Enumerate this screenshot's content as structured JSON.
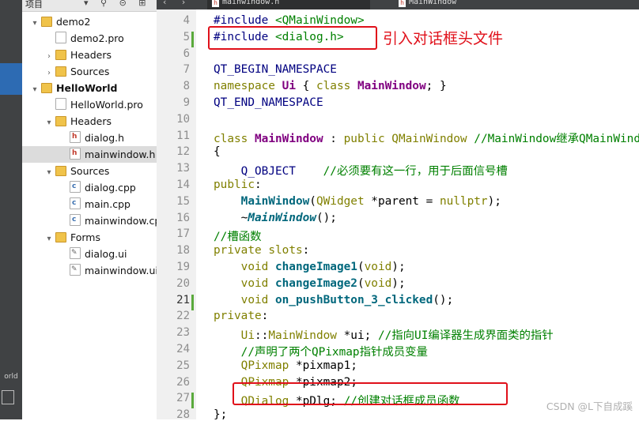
{
  "left_bar": {
    "label": "orld"
  },
  "project_tree": {
    "title": "项目",
    "toolbar_icons": [
      "filter-icon",
      "link-icon",
      "split-icon",
      "plus-icon"
    ],
    "items": [
      {
        "label": "demo2",
        "depth": 0,
        "type": "proj",
        "bold": false,
        "arrow": "▾"
      },
      {
        "label": "demo2.pro",
        "depth": 1,
        "type": "pro",
        "bold": false,
        "arrow": ""
      },
      {
        "label": "Headers",
        "depth": 1,
        "type": "folder",
        "bold": false,
        "arrow": "›"
      },
      {
        "label": "Sources",
        "depth": 1,
        "type": "folder",
        "bold": false,
        "arrow": "›"
      },
      {
        "label": "HelloWorld",
        "depth": 0,
        "type": "proj",
        "bold": true,
        "arrow": "▾"
      },
      {
        "label": "HelloWorld.pro",
        "depth": 1,
        "type": "pro",
        "bold": false,
        "arrow": ""
      },
      {
        "label": "Headers",
        "depth": 1,
        "type": "folder",
        "bold": false,
        "arrow": "▾"
      },
      {
        "label": "dialog.h",
        "depth": 2,
        "type": "hfile",
        "bold": false,
        "arrow": ""
      },
      {
        "label": "mainwindow.h",
        "depth": 2,
        "type": "hfile",
        "bold": false,
        "arrow": "",
        "selected": true
      },
      {
        "label": "Sources",
        "depth": 1,
        "type": "folder",
        "bold": false,
        "arrow": "▾"
      },
      {
        "label": "dialog.cpp",
        "depth": 2,
        "type": "cfile",
        "bold": false,
        "arrow": ""
      },
      {
        "label": "main.cpp",
        "depth": 2,
        "type": "cfile",
        "bold": false,
        "arrow": ""
      },
      {
        "label": "mainwindow.cpp",
        "depth": 2,
        "type": "cfile",
        "bold": false,
        "arrow": ""
      },
      {
        "label": "Forms",
        "depth": 1,
        "type": "forms",
        "bold": false,
        "arrow": "▾"
      },
      {
        "label": "dialog.ui",
        "depth": 2,
        "type": "ui",
        "bold": false,
        "arrow": ""
      },
      {
        "label": "mainwindow.ui",
        "depth": 2,
        "type": "ui",
        "bold": false,
        "arrow": ""
      }
    ]
  },
  "tabs": {
    "active": "mainwindow.h",
    "second": "MainWindow"
  },
  "editor": {
    "lines": [
      {
        "n": "4",
        "html": "<span class=\"mc\">#include</span> <span class=\"st\">&lt;QMainWindow&gt;</span>"
      },
      {
        "n": "5",
        "html": "<span class=\"mc\">#include</span> <span class=\"st\">&lt;dialog.h&gt;</span>"
      },
      {
        "n": "6",
        "html": ""
      },
      {
        "n": "7",
        "html": "<span class=\"ma\">QT_BEGIN_NAMESPACE</span>"
      },
      {
        "n": "8",
        "html": "<span class=\"kw\">namespace</span> <span class=\"ty\">Ui</span> { <span class=\"kw\">class</span> <span class=\"ty\">MainWindow</span>; }"
      },
      {
        "n": "9",
        "html": "<span class=\"ma\">QT_END_NAMESPACE</span>"
      },
      {
        "n": "10",
        "html": ""
      },
      {
        "n": "11",
        "html": "<span class=\"kw\">class</span> <span class=\"ty\">MainWindow</span> : <span class=\"kw\">public</span> <span class=\"kw\">QMainWindow</span> <span class=\"cm\">//MainWindow继承QMainWindow类</span>"
      },
      {
        "n": "12",
        "html": "{"
      },
      {
        "n": "13",
        "html": "    <span class=\"ma\">Q_OBJECT</span>    <span class=\"cm\">//必须要有这一行，用于后面信号槽</span>"
      },
      {
        "n": "14",
        "html": "<span class=\"kw\">public</span>:"
      },
      {
        "n": "15",
        "html": "    <span class=\"fn\">MainWindow</span>(<span class=\"kw\">QWidget</span> *<span class=\"ty\" style=\"font-weight:normal;color:#000\">parent</span> = <span class=\"kw\">nullptr</span>);"
      },
      {
        "n": "16",
        "html": "    ~<span class=\"fni\">MainWindow</span>();"
      },
      {
        "n": "17",
        "html": "<span class=\"cm\">//槽函数</span>"
      },
      {
        "n": "18",
        "html": "<span class=\"kw\">private</span> <span class=\"kw\">slots</span>:"
      },
      {
        "n": "19",
        "html": "    <span class=\"kw\">void</span> <span class=\"fn\">changeImage1</span>(<span class=\"kw\">void</span>);"
      },
      {
        "n": "20",
        "html": "    <span class=\"kw\">void</span> <span class=\"fn\">changeImage2</span>(<span class=\"kw\">void</span>);"
      },
      {
        "n": "21",
        "html": "    <span class=\"kw\">void</span> <span class=\"fn\">on_pushButton_3_clicked</span>();"
      },
      {
        "n": "22",
        "html": "<span class=\"kw\">private</span>:"
      },
      {
        "n": "23",
        "html": "    <span class=\"kw\">Ui</span>::<span class=\"kw\">MainWindow</span> *ui; <span class=\"cm\">//指向UI编译器生成界面类的指针</span>"
      },
      {
        "n": "24",
        "html": "    <span class=\"cm\">//声明了两个QPixmap指针成员变量</span>"
      },
      {
        "n": "25",
        "html": "    <span class=\"kw\">QPixmap</span> *pixmap1;"
      },
      {
        "n": "26",
        "html": "    <span class=\"kw\">QPixmap</span> *pixmap2;"
      },
      {
        "n": "27",
        "html": "    <span class=\"kw\">QDialog</span> *pDlg; <span class=\"cm\">//创建对话框成员函数</span>"
      },
      {
        "n": "28",
        "html": "};"
      }
    ],
    "active_line": "21"
  },
  "annotation": "引入对话框头文件",
  "watermark": "CSDN @L下自成蹊",
  "colors": {
    "red": "#e0101a",
    "keyword": "#808000",
    "type": "#800080",
    "function": "#00677c",
    "comment": "#008000",
    "macro": "#000080"
  }
}
